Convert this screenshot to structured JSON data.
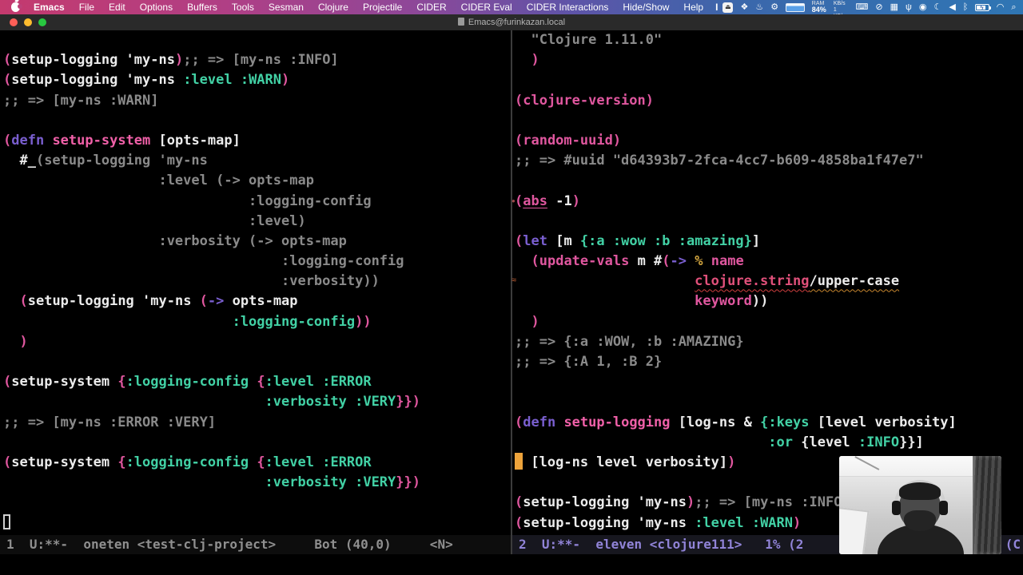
{
  "menu_bar": {
    "items": [
      "Emacs",
      "File",
      "Edit",
      "Options",
      "Buffers",
      "Tools",
      "Sesman",
      "Clojure",
      "Projectile",
      "CIDER",
      "CIDER Eval",
      "CIDER Interactions",
      "Hide/Show",
      "Help"
    ],
    "text_cursor_glyph": "I",
    "icons_before": [
      {
        "name": "menu-app-icon",
        "glyph": "⏏"
      },
      {
        "name": "extension-icon",
        "glyph": "❖"
      },
      {
        "name": "caffeine-icon",
        "glyph": "♨"
      },
      {
        "name": "gear-icon",
        "glyph": "⚙"
      }
    ],
    "ram": {
      "label": "RAM",
      "value": "84%"
    },
    "net": {
      "up": "1 KB/s",
      "down": "1 KB/s"
    },
    "icons_mid": [
      {
        "name": "keyboard-icon",
        "glyph": "⌨"
      },
      {
        "name": "dnd-icon",
        "glyph": "⊘"
      },
      {
        "name": "input-source-icon",
        "glyph": "▦"
      },
      {
        "name": "usb-icon",
        "glyph": "ψ"
      },
      {
        "name": "play-circle-icon",
        "glyph": "◉"
      },
      {
        "name": "moon-icon",
        "glyph": "☾"
      },
      {
        "name": "volume-icon",
        "glyph": "◀"
      },
      {
        "name": "bluetooth-icon",
        "glyph": "ᛒ"
      }
    ],
    "icons_end": [
      {
        "name": "wifi-icon",
        "glyph": "◠"
      },
      {
        "name": "search-icon",
        "glyph": "⌕"
      },
      {
        "name": "control-center-icon",
        "glyph": "⧉"
      },
      {
        "name": "app-purple-icon",
        "glyph": "●"
      },
      {
        "name": "clock-icon",
        "glyph": "◷"
      }
    ]
  },
  "title_bar": {
    "title": "Emacs@furinkazan.local"
  },
  "left_window": {
    "lines": [
      [],
      [
        [
          "p",
          "("
        ],
        [
          "w",
          "setup-logging 'my-ns"
        ],
        [
          "p",
          ")"
        ],
        [
          "g",
          ";; => [my-ns :INFO]"
        ]
      ],
      [
        [
          "p",
          "("
        ],
        [
          "w",
          "setup-logging 'my-ns "
        ],
        [
          "k",
          ":level :WARN"
        ],
        [
          "p",
          ")"
        ]
      ],
      [
        [
          "g",
          ";; => [my-ns :WARN]"
        ]
      ],
      [],
      [
        [
          "p",
          "("
        ],
        [
          "v",
          "defn "
        ],
        [
          "f",
          "setup-system "
        ],
        [
          "w",
          "[opts-map]"
        ]
      ],
      [
        [
          "w",
          "  #_"
        ],
        [
          "g",
          "(setup-logging 'my-ns"
        ]
      ],
      [
        [
          "g",
          "                   :level (-> opts-map"
        ]
      ],
      [
        [
          "g",
          "                              :logging-config"
        ]
      ],
      [
        [
          "g",
          "                              :level)"
        ]
      ],
      [
        [
          "g",
          "                   :verbosity (-> opts-map"
        ]
      ],
      [
        [
          "g",
          "                                  :logging-config"
        ]
      ],
      [
        [
          "g",
          "                                  :verbosity))"
        ]
      ],
      [
        [
          "w",
          "  "
        ],
        [
          "p",
          "("
        ],
        [
          "w",
          "setup-logging 'my-ns "
        ],
        [
          "p",
          "("
        ],
        [
          "v",
          "-> "
        ],
        [
          "w",
          "opts-map"
        ]
      ],
      [
        [
          "w",
          "                            "
        ],
        [
          "k",
          ":logging-config"
        ],
        [
          "p",
          "))"
        ]
      ],
      [
        [
          "w",
          "  "
        ],
        [
          "p",
          ")"
        ]
      ],
      [],
      [
        [
          "p",
          "("
        ],
        [
          "w",
          "setup-system "
        ],
        [
          "p",
          "{"
        ],
        [
          "k",
          ":logging-config "
        ],
        [
          "p",
          "{"
        ],
        [
          "k",
          ":level :ERROR"
        ]
      ],
      [
        [
          "w",
          "                                "
        ],
        [
          "k",
          ":verbosity :VERY"
        ],
        [
          "p",
          "}})"
        ]
      ],
      [
        [
          "g",
          ";; => [my-ns :ERROR :VERY]"
        ]
      ],
      [],
      [
        [
          "p",
          "("
        ],
        [
          "w",
          "setup-system "
        ],
        [
          "p",
          "{"
        ],
        [
          "k",
          ":logging-config "
        ],
        [
          "p",
          "{"
        ],
        [
          "k",
          ":level :ERROR"
        ]
      ],
      [
        [
          "w",
          "                                "
        ],
        [
          "k",
          ":verbosity :VERY"
        ],
        [
          "p",
          "}})"
        ]
      ],
      [],
      [
        [
          "hcur",
          " "
        ]
      ]
    ]
  },
  "right_window": {
    "lines": [
      [
        [
          "g",
          "  \"Clojure 1.11.0\""
        ]
      ],
      [
        [
          "p",
          "  )"
        ]
      ],
      [],
      [
        [
          "c",
          "(clojure-version)"
        ]
      ],
      [],
      [
        [
          "c",
          "(random-uuid)"
        ]
      ],
      [
        [
          "g",
          ";; => #uuid \"d64393b7-2fca-4cc7-b609-4858ba1f47e7\""
        ]
      ],
      [],
      [
        [
          "p",
          "("
        ],
        [
          "cu",
          "abs"
        ],
        [
          "w",
          " -1"
        ],
        [
          "p",
          ")"
        ]
      ],
      [],
      [
        [
          "p",
          "("
        ],
        [
          "v",
          "let "
        ],
        [
          "w",
          "[m "
        ],
        [
          "k",
          "{:a :wow :b :amazing}"
        ],
        [
          "w",
          "]"
        ]
      ],
      [
        [
          "w",
          "  "
        ],
        [
          "p",
          "("
        ],
        [
          "c",
          "update-vals "
        ],
        [
          "w",
          "m #"
        ],
        [
          "p",
          "("
        ],
        [
          "v",
          "-> "
        ],
        [
          "y",
          "% "
        ],
        [
          "c",
          "name"
        ]
      ],
      [
        [
          "w",
          "                      "
        ],
        [
          "eu",
          "clojure.string"
        ],
        [
          "wu",
          "/upper-case"
        ]
      ],
      [
        [
          "w",
          "                      "
        ],
        [
          "c",
          "keyword"
        ],
        [
          "w",
          "))"
        ]
      ],
      [
        [
          "w",
          "  "
        ],
        [
          "p",
          ")"
        ]
      ],
      [
        [
          "g",
          ";; => {:a :WOW, :b :AMAZING}"
        ]
      ],
      [
        [
          "g",
          ";; => {:A 1, :B 2}"
        ]
      ],
      [],
      [],
      [
        [
          "p",
          "("
        ],
        [
          "v",
          "defn "
        ],
        [
          "f",
          "setup-logging "
        ],
        [
          "w",
          "[log-ns & "
        ],
        [
          "k",
          "{:keys "
        ],
        [
          "w",
          "[level verbosity]"
        ]
      ],
      [
        [
          "w",
          "                               "
        ],
        [
          "k",
          ":or "
        ],
        [
          "w",
          "{level "
        ],
        [
          "k",
          ":INFO"
        ],
        [
          "w",
          "}}]"
        ]
      ],
      [
        [
          "cur",
          " "
        ],
        [
          "w",
          " [log-ns level verbosity]"
        ],
        [
          "p",
          ")"
        ]
      ],
      [],
      [
        [
          "p",
          "("
        ],
        [
          "w",
          "setup-logging 'my-ns"
        ],
        [
          "p",
          ")"
        ],
        [
          "g",
          ";; => [my-ns :INFO]"
        ]
      ],
      [
        [
          "p",
          "("
        ],
        [
          "w",
          "setup-logging 'my-ns "
        ],
        [
          "k",
          ":level :WARN"
        ],
        [
          "p",
          ")"
        ]
      ]
    ]
  },
  "modelines": {
    "left": "1  U:**-  oneten <test-clj-project>     Bot (40,0)     <N>",
    "right": "2  U:**-  eleven <clojure111>   1% (2",
    "right_tail": "(C"
  },
  "colors": {
    "paren_pink": "#e0579f",
    "keyword_teal": "#42d1a5",
    "macro_violet": "#7a5fd0",
    "comment_gray": "#8a8a8a",
    "cursor_orange": "#eda33b",
    "error_red": "#d23f3f",
    "modeline_active_text": "#9184d8",
    "menubar_left": "#c43a6e",
    "menubar_right": "#2f76b4",
    "ram_gauge_blue": "#5aa0e8",
    "traffic_red": "#ff5f57",
    "traffic_yellow": "#febc2e",
    "traffic_green": "#28c840"
  }
}
